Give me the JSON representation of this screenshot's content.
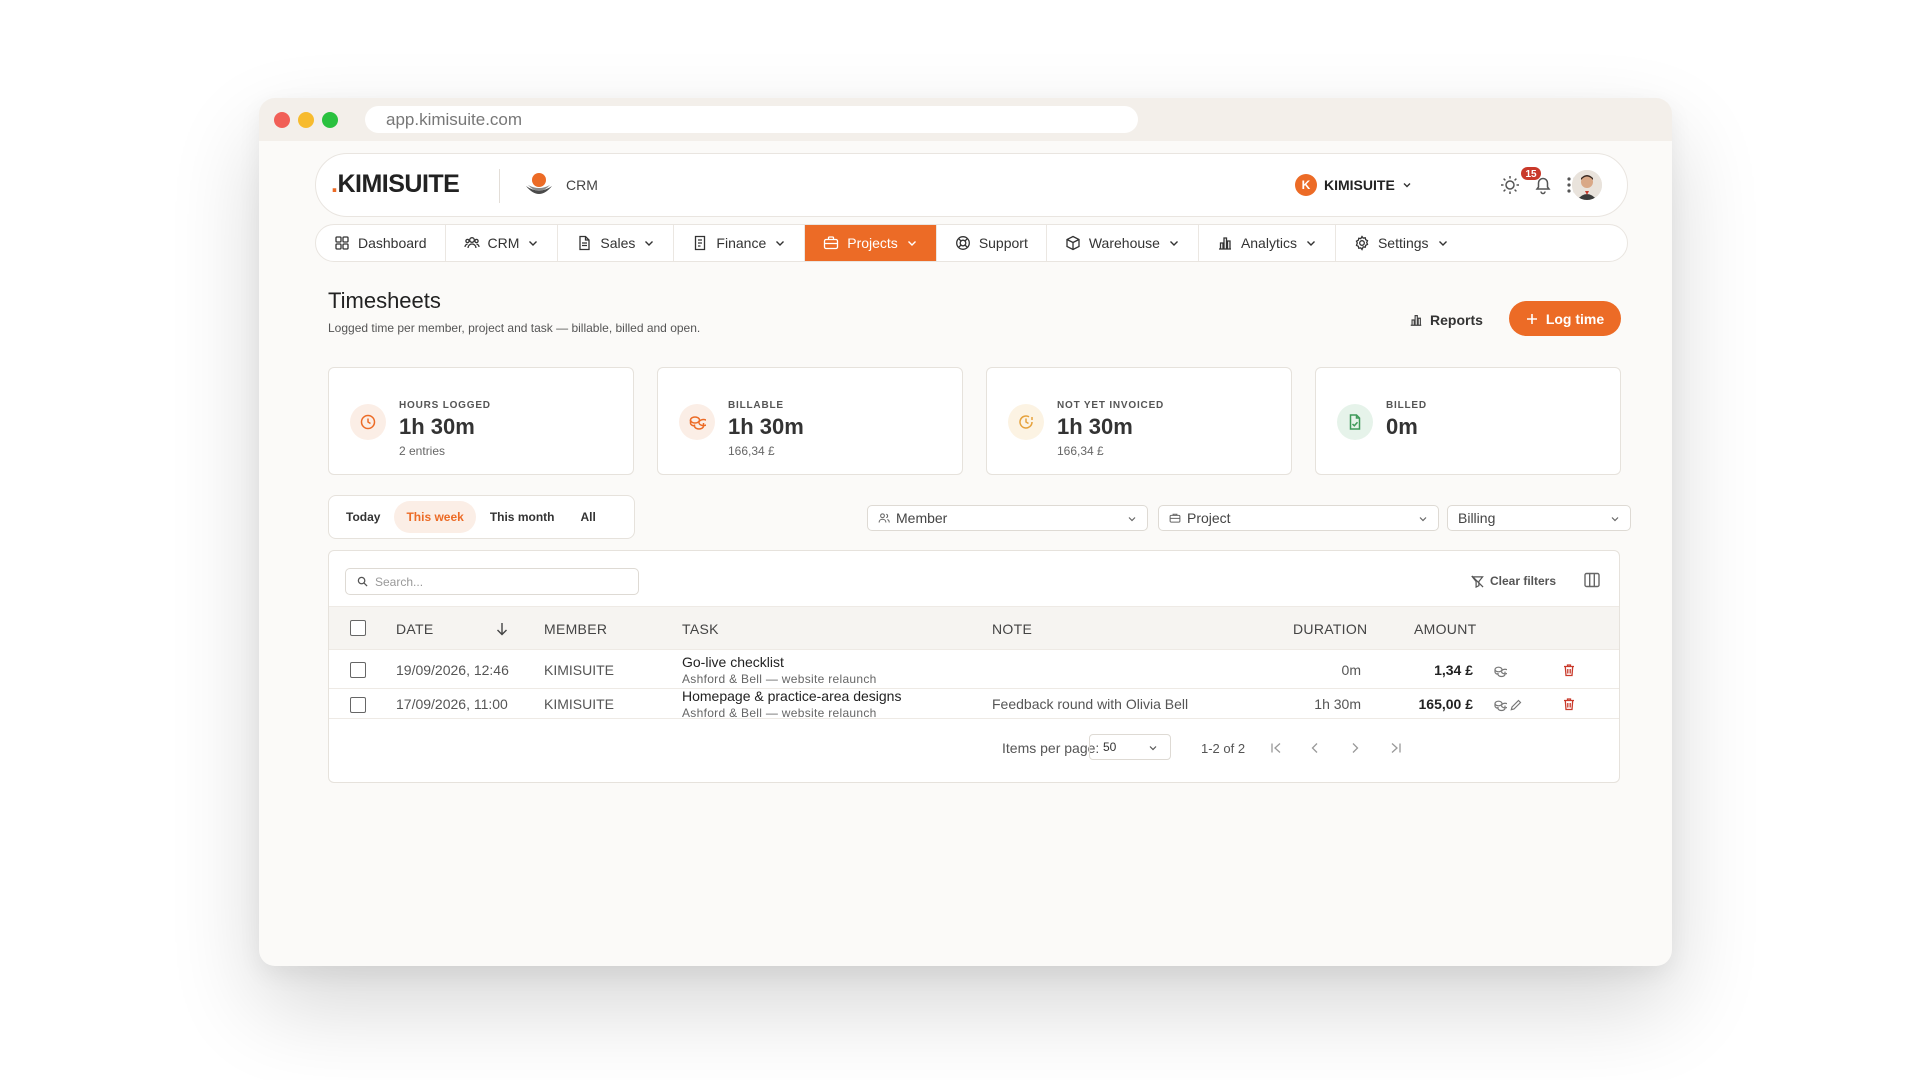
{
  "browser": {
    "url": "app.kimisuite.com"
  },
  "header": {
    "logo_dot": ".",
    "logo_text": "KIMISUITE",
    "module_label": "CRM",
    "company_initial": "K",
    "company_name": "KIMISUITE",
    "notification_count": "15"
  },
  "nav": {
    "items": [
      {
        "label": "Dashboard",
        "icon": "dashboard-icon",
        "dropdown": false
      },
      {
        "label": "CRM",
        "icon": "users-icon",
        "dropdown": true
      },
      {
        "label": "Sales",
        "icon": "document-icon",
        "dropdown": true
      },
      {
        "label": "Finance",
        "icon": "invoice-icon",
        "dropdown": true
      },
      {
        "label": "Projects",
        "icon": "briefcase-icon",
        "dropdown": true,
        "active": true
      },
      {
        "label": "Support",
        "icon": "lifebuoy-icon",
        "dropdown": false
      },
      {
        "label": "Warehouse",
        "icon": "box-icon",
        "dropdown": true
      },
      {
        "label": "Analytics",
        "icon": "bar-chart-icon",
        "dropdown": true
      },
      {
        "label": "Settings",
        "icon": "gear-icon",
        "dropdown": true
      }
    ]
  },
  "page": {
    "title": "Timesheets",
    "subtitle": "Logged time per member, project and task — billable, billed and open.",
    "reports_label": "Reports",
    "log_time_label": "Log time"
  },
  "stats": [
    {
      "label": "HOURS LOGGED",
      "value": "1h 30m",
      "sub": "2 entries",
      "icon": "clock-icon",
      "color": "#ec6b26",
      "bg": "#fbeee6"
    },
    {
      "label": "BILLABLE",
      "value": "1h 30m",
      "sub": "166,34 £",
      "icon": "coins-icon",
      "color": "#ec6b26",
      "bg": "#fbeee6"
    },
    {
      "label": "NOT YET INVOICED",
      "value": "1h 30m",
      "sub": "166,34 £",
      "icon": "clock-alert-icon",
      "color": "#e6a23c",
      "bg": "#fcf3e3"
    },
    {
      "label": "BILLED",
      "value": "0m",
      "sub": "",
      "icon": "file-check-icon",
      "color": "#3f9a5a",
      "bg": "#e6f3ea"
    }
  ],
  "filters": {
    "periods": [
      "Today",
      "This week",
      "This month",
      "All"
    ],
    "active_period": "This week",
    "member_placeholder": "Member",
    "project_placeholder": "Project",
    "billing_placeholder": "Billing"
  },
  "table": {
    "search_placeholder": "Search...",
    "clear_filters_label": "Clear filters",
    "columns": {
      "date": "DATE",
      "member": "MEMBER",
      "task": "TASK",
      "note": "NOTE",
      "duration": "DURATION",
      "amount": "AMOUNT"
    },
    "rows": [
      {
        "date": "19/09/2026, 12:46",
        "member": "KIMISUITE",
        "task": "Go-live checklist",
        "project": "Ashford & Bell — website relaunch",
        "note": "",
        "duration": "0m",
        "amount": "1,34 £"
      },
      {
        "date": "17/09/2026, 11:00",
        "member": "KIMISUITE",
        "task": "Homepage & practice-area designs",
        "project": "Ashford & Bell — website relaunch",
        "note": "Feedback round with Olivia Bell",
        "duration": "1h 30m",
        "amount": "165,00 £"
      }
    ],
    "items_per_page_label": "Items per page:",
    "items_per_page": "50",
    "range_label": "1-2 of 2"
  }
}
